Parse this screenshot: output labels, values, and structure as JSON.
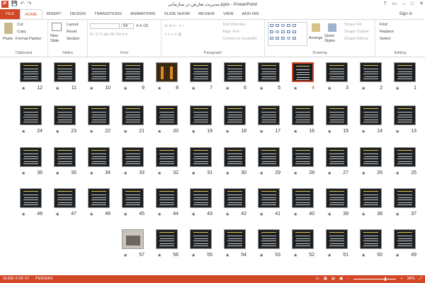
{
  "app": {
    "title": "مدیریت تعارض در سازمانی.pptx - PowerPoint",
    "signin": "Sign in",
    "help": "?"
  },
  "quickaccess": {
    "save": "💾",
    "undo": "↶",
    "redo": "↷"
  },
  "tabs": [
    "FILE",
    "HOME",
    "INSERT",
    "DESIGN",
    "TRANSITIONS",
    "ANIMATIONS",
    "SLIDE SHOW",
    "REVIEW",
    "VIEW",
    "ADD-INS"
  ],
  "active_tab": "HOME",
  "ribbon": {
    "clipboard": {
      "label": "Clipboard",
      "paste": "Paste",
      "cut": "Cut",
      "copy": "Copy",
      "format_painter": "Format Painter"
    },
    "slides": {
      "label": "Slides",
      "new_slide": "New Slide",
      "layout": "Layout",
      "reset": "Reset",
      "section": "Section"
    },
    "font": {
      "label": "Font",
      "size": "54"
    },
    "paragraph": {
      "label": "Paragraph",
      "text_direction": "Text Direction",
      "align_text": "Align Text",
      "convert": "Convert to SmartArt"
    },
    "drawing": {
      "label": "Drawing",
      "arrange": "Arrange",
      "quick_styles": "Quick Styles",
      "shape_fill": "Shape Fill",
      "shape_outline": "Shape Outline",
      "shape_effects": "Shape Effects"
    },
    "editing": {
      "label": "Editing",
      "find": "Find",
      "replace": "Replace",
      "select": "Select"
    }
  },
  "slides": [
    [
      12,
      11,
      10,
      9,
      8,
      7,
      6,
      5,
      4,
      3,
      2,
      1
    ],
    [
      24,
      23,
      22,
      21,
      20,
      19,
      18,
      17,
      16,
      15,
      14,
      13
    ],
    [
      36,
      35,
      34,
      33,
      32,
      31,
      30,
      29,
      28,
      27,
      26,
      25
    ],
    [
      48,
      47,
      46,
      45,
      44,
      43,
      42,
      41,
      40,
      39,
      38,
      37
    ],
    [
      57,
      56,
      55,
      54,
      53,
      52,
      51,
      50,
      49
    ]
  ],
  "selected_slide": 4,
  "status": {
    "slide": "SLIDE 4 OF 57",
    "language": "PERSIAN",
    "zoom": "38%"
  },
  "colors": {
    "accent": "#d24726"
  }
}
